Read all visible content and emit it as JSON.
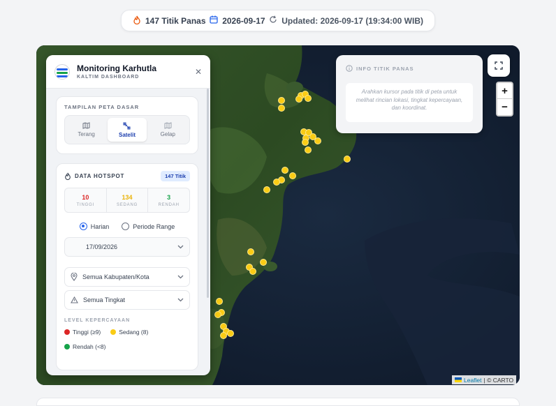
{
  "statusbar": {
    "hotspot_count": "147 Titik Panas",
    "date": "2026-09-17",
    "updated": "Updated: 2026-09-17 (19:34:00 WIB)"
  },
  "panel": {
    "title": "Monitoring Karhutla",
    "subtitle": "KALTIM DASHBOARD",
    "basemap": {
      "title": "TAMPILAN PETA DASAR",
      "options": [
        {
          "label": "Terang",
          "icon": "map-icon"
        },
        {
          "label": "Satelit",
          "icon": "satellite-icon"
        },
        {
          "label": "Gelap",
          "icon": "map-icon"
        }
      ],
      "selected": "Satelit"
    },
    "hotspot": {
      "title": "DATA HOTSPOT",
      "badge": "147 Titik",
      "stats": [
        {
          "value": "10",
          "label": "TINGGI",
          "color": "#dc2626"
        },
        {
          "value": "134",
          "label": "SEDANG",
          "color": "#eab308"
        },
        {
          "value": "3",
          "label": "RENDAH",
          "color": "#16a34a"
        }
      ],
      "radio_daily": "Harian",
      "radio_range": "Periode Range",
      "date_value": "17/09/2026",
      "region": "Semua Kabupaten/Kota",
      "level": "Semua Tingkat"
    },
    "confidence": {
      "title": "LEVEL KEPERCAYAAN",
      "high": "Tinggi (≥9)",
      "medium": "Sedang (8)",
      "low": "Rendah (<8)"
    }
  },
  "info": {
    "title": "INFO TITIK PANAS",
    "body": "Arahkan kursor pada titik di peta untuk melihat rincian lokasi, tingkat kepercayaan, dan koordinat."
  },
  "zoom": {
    "in": "+",
    "out": "−"
  },
  "attribution": {
    "leaflet": "Leaflet",
    "rest": "| © CARTO"
  },
  "colors": {
    "accent": "#2563eb",
    "hotspot": "#facc15",
    "high": "#dc2626",
    "medium": "#facc15",
    "low": "#16a34a"
  }
}
